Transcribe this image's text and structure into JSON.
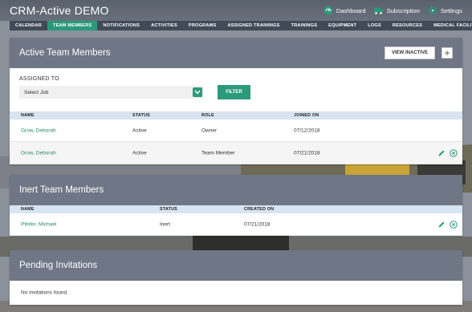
{
  "header": {
    "brand": "CRM-Active DEMO",
    "links": [
      {
        "label": "Dashboard",
        "icon": "dashboard-gauge-icon"
      },
      {
        "label": "Subscription",
        "icon": "subscription-truck-icon"
      },
      {
        "label": "Settings",
        "icon": "gear-icon"
      }
    ]
  },
  "nav": {
    "items": [
      "CALENDAR",
      "TEAM MEMBERS",
      "NOTIFICATIONS",
      "ACTIVITIES",
      "PROGRAMS",
      "ASSIGNED TRAININGS",
      "TRAININGS",
      "EQUIPMENT",
      "LOGS",
      "RESOURCES",
      "MEDICAL FACILITIES"
    ],
    "active": "TEAM MEMBERS"
  },
  "active_members": {
    "title": "Active Team Members",
    "view_inactive_label": "VIEW INACTIVE",
    "add_label": "+",
    "filter": {
      "label": "ASSIGNED TO",
      "select_value": "Select Job",
      "button_label": "FILTER"
    },
    "columns": [
      "NAME",
      "STATUS",
      "ROLE",
      "JOINED ON"
    ],
    "rows": [
      {
        "name": "Grow, Deborah",
        "status": "Active",
        "role": "Owner",
        "joined": "07/12/2018"
      },
      {
        "name": "Grow, Deborah",
        "status": "Active",
        "role": "Team Member",
        "joined": "07/21/2018"
      }
    ]
  },
  "inert_members": {
    "title": "Inert Team Members",
    "columns": [
      "NAME",
      "STATUS",
      "CREATED ON"
    ],
    "rows": [
      {
        "name": "Pfeifer, Michael",
        "status": "Inert",
        "created": "07/21/2018"
      }
    ]
  },
  "pending": {
    "title": "Pending Invitations",
    "empty_text": "No invitations found."
  },
  "colors": {
    "accent": "#2a9a7a",
    "nav_bg": "#414a58",
    "panel_head": "#6f7685",
    "table_head": "#d8e4f1"
  }
}
